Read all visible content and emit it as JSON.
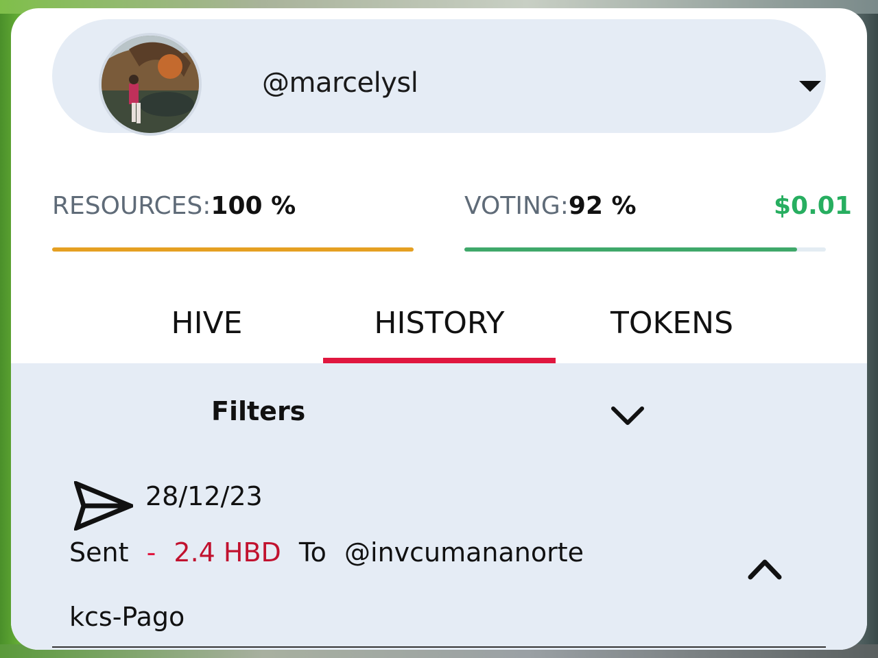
{
  "account": {
    "username": "@marcelysl",
    "avatar_alt": "avatar"
  },
  "stats": {
    "resources_label": "RESOURCES:",
    "resources_value": "100 %",
    "resources_level": 1.0,
    "voting_label": "VOTING:",
    "voting_value": "92 %",
    "voting_level": 0.92,
    "vote_value": "$0.01"
  },
  "tabs": [
    {
      "label": "HIVE",
      "active": false
    },
    {
      "label": "HISTORY",
      "active": true
    },
    {
      "label": "TOKENS",
      "active": false
    }
  ],
  "history": {
    "filters_label": "Filters",
    "transactions": [
      {
        "icon": "send-icon",
        "date": "28/12/23",
        "type": "Sent",
        "dash": "-",
        "amount": "2.4 HBD",
        "to_label": "To",
        "recipient": "@invcumananorte",
        "memo": "kcs-Pago"
      }
    ]
  },
  "colors": {
    "accent": "#e0173f",
    "resources_bar": "#e5a022",
    "voting_bar": "#3fa86a",
    "vote_value": "#27ae60",
    "panel_bg": "#e5ecf5"
  }
}
